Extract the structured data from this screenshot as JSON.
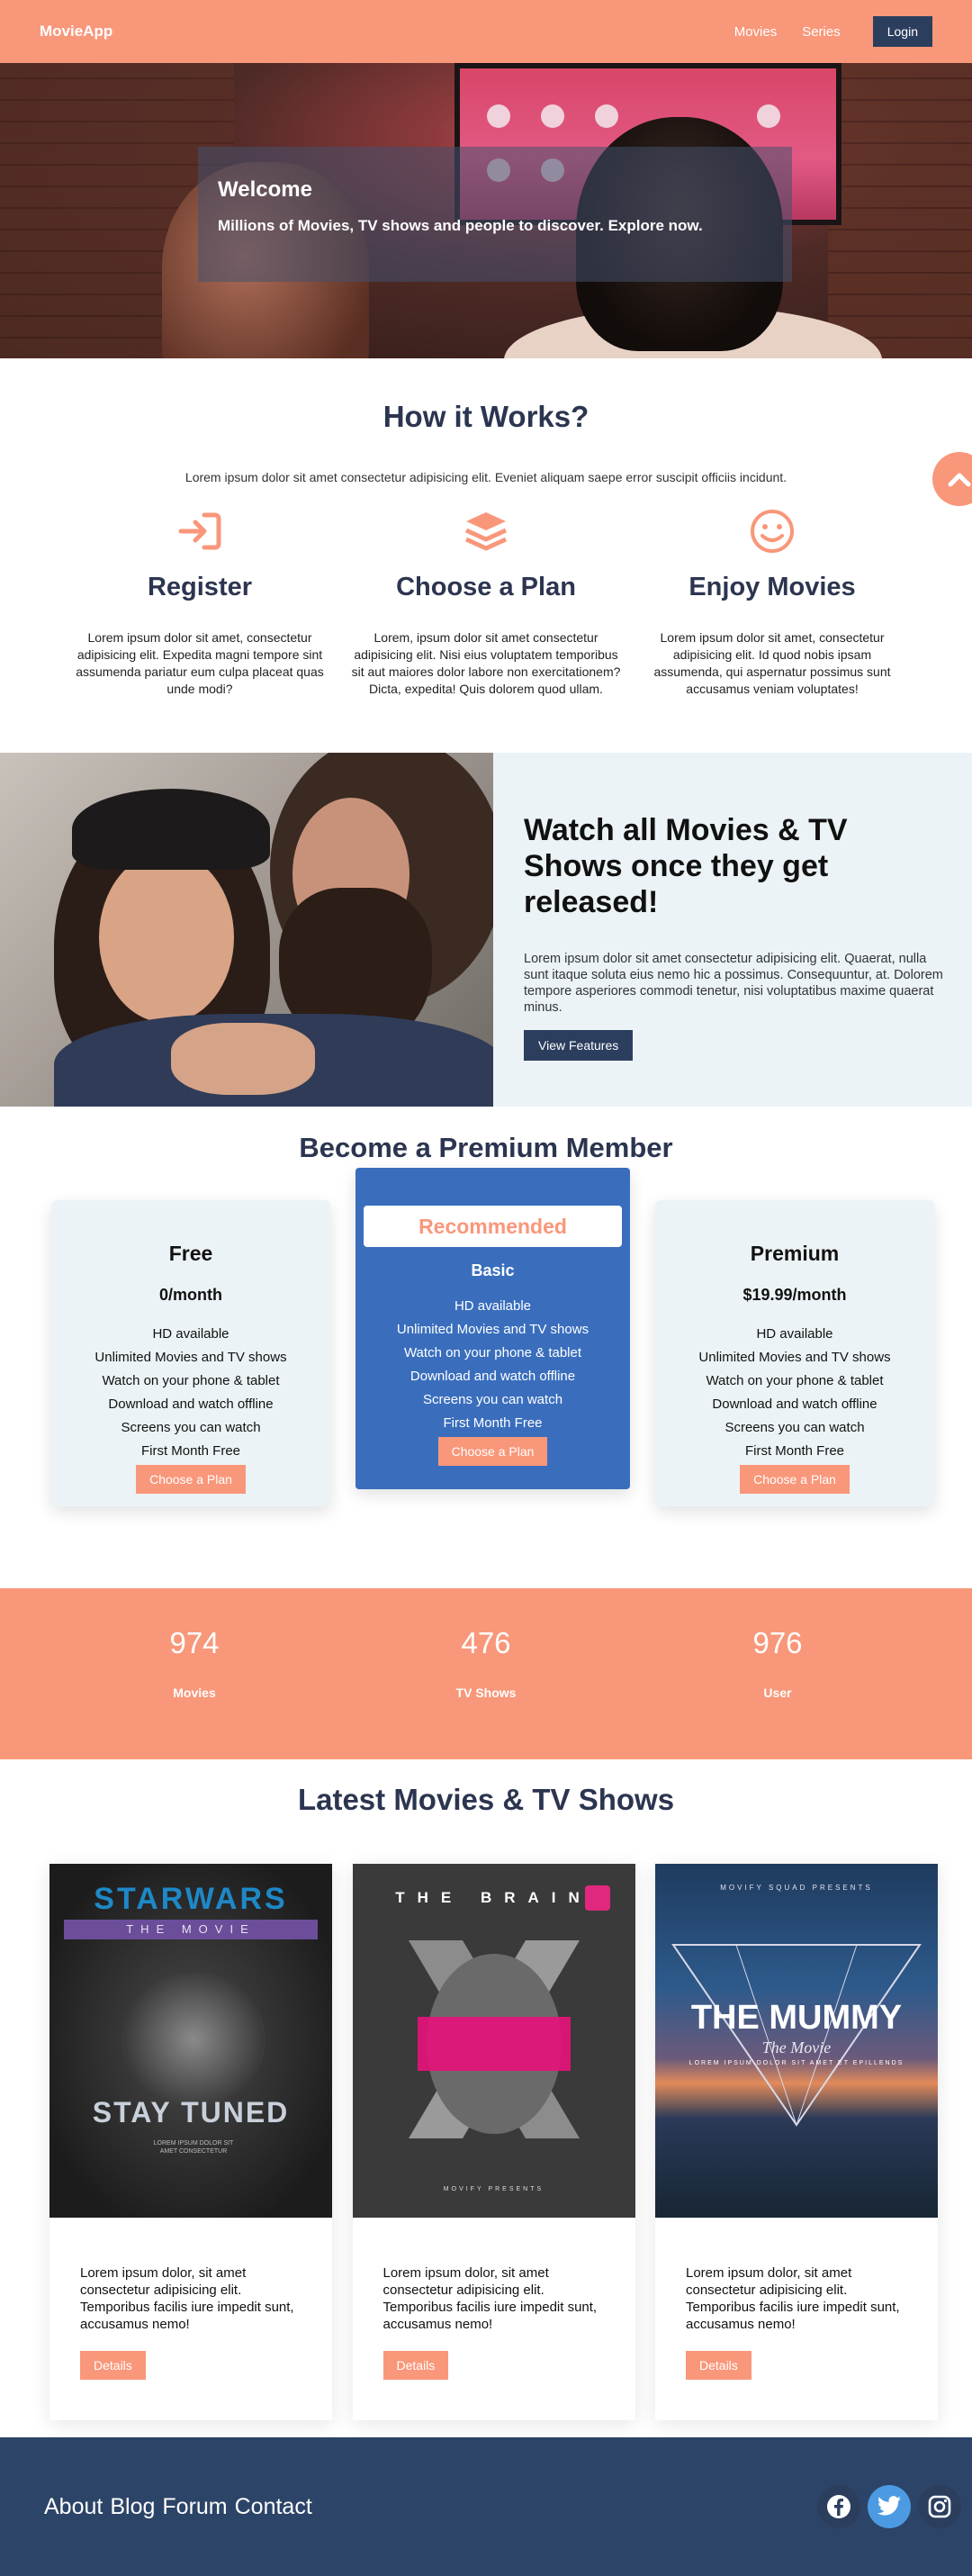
{
  "nav": {
    "brand": "MovieApp",
    "links": [
      "Movies",
      "Series"
    ],
    "login": "Login"
  },
  "hero": {
    "title": "Welcome",
    "subtitle": "Millions of Movies, TV shows and people to discover. Explore now."
  },
  "how": {
    "title": "How it Works?",
    "intro": "Lorem ipsum dolor sit amet consectetur adipisicing elit. Eveniet aliquam saepe error suscipit officiis incidunt.",
    "steps": [
      {
        "icon": "sign-in-icon",
        "title": "Register",
        "text": "Lorem ipsum dolor sit amet, consectetur adipisicing elit. Expedita magni tempore sint assumenda pariatur eum culpa placeat quas unde modi?"
      },
      {
        "icon": "layers-icon",
        "title": "Choose a Plan",
        "text": "Lorem, ipsum dolor sit amet consectetur adipisicing elit. Nisi eius voluptatem temporibus sit aut maiores dolor labore non exercitationem? Dicta, expedita! Quis dolorem quod ullam."
      },
      {
        "icon": "smile-icon",
        "title": "Enjoy Movies",
        "text": "Lorem ipsum dolor sit amet, consectetur adipisicing elit. Id quod nobis ipsam assumenda, qui aspernatur possimus sunt accusamus veniam voluptates!"
      }
    ]
  },
  "feature": {
    "title": "Watch all Movies & TV Shows once they get released!",
    "text": "Lorem ipsum dolor sit amet consectetur adipisicing elit. Quaerat, nulla sunt itaque soluta eius nemo hic a possimus. Consequuntur, at. Dolorem tempore asperiores commodi tenetur, nisi voluptatibus maxime quaerat minus.",
    "button": "View Features"
  },
  "pricing": {
    "title": "Become a Premium Member",
    "features": [
      "HD available",
      "Unlimited Movies and TV shows",
      "Watch on your phone & tablet",
      "Download and watch offline",
      "Screens you can watch",
      "First Month Free"
    ],
    "button": "Choose a Plan",
    "recommended": "Recommended",
    "plans": [
      {
        "name": "Free",
        "price": "0/month"
      },
      {
        "name": "Basic"
      },
      {
        "name": "Premium",
        "price": "$19.99/month"
      }
    ]
  },
  "stats": [
    {
      "value": "974",
      "label": "Movies"
    },
    {
      "value": "476",
      "label": "TV Shows"
    },
    {
      "value": "976",
      "label": "User"
    }
  ],
  "latest": {
    "title": "Latest Movies & TV Shows",
    "text": "Lorem ipsum dolor, sit amet consectetur adipisicing elit. Temporibus facilis iure impedit sunt, accusamus nemo!",
    "button": "Details",
    "posters": [
      {
        "line1": "STARWARS",
        "line2": "THE MOVIE",
        "line3": "STAY TUNED",
        "fine": "LOREM IPSUM DOLOR SIT AMET CONSECTETUR"
      },
      {
        "line1": "THE BRAIN",
        "line2": "MOVIFY PRESENTS"
      },
      {
        "line1": "MOVIFY SQUAD PRESENTS",
        "line2": "THE MUMMY",
        "line3": "The Movie",
        "fine": "LOREM IPSUM DOLOR SIT AMET ET EPILLENDS"
      }
    ]
  },
  "footer": {
    "links": [
      "About",
      "Blog",
      "Forum",
      "Contact"
    ]
  },
  "colors": {
    "accent": "#f9977a",
    "navy": "#2c3e5e",
    "recommended_card": "#3a6ebd",
    "footer": "#2c4467"
  }
}
